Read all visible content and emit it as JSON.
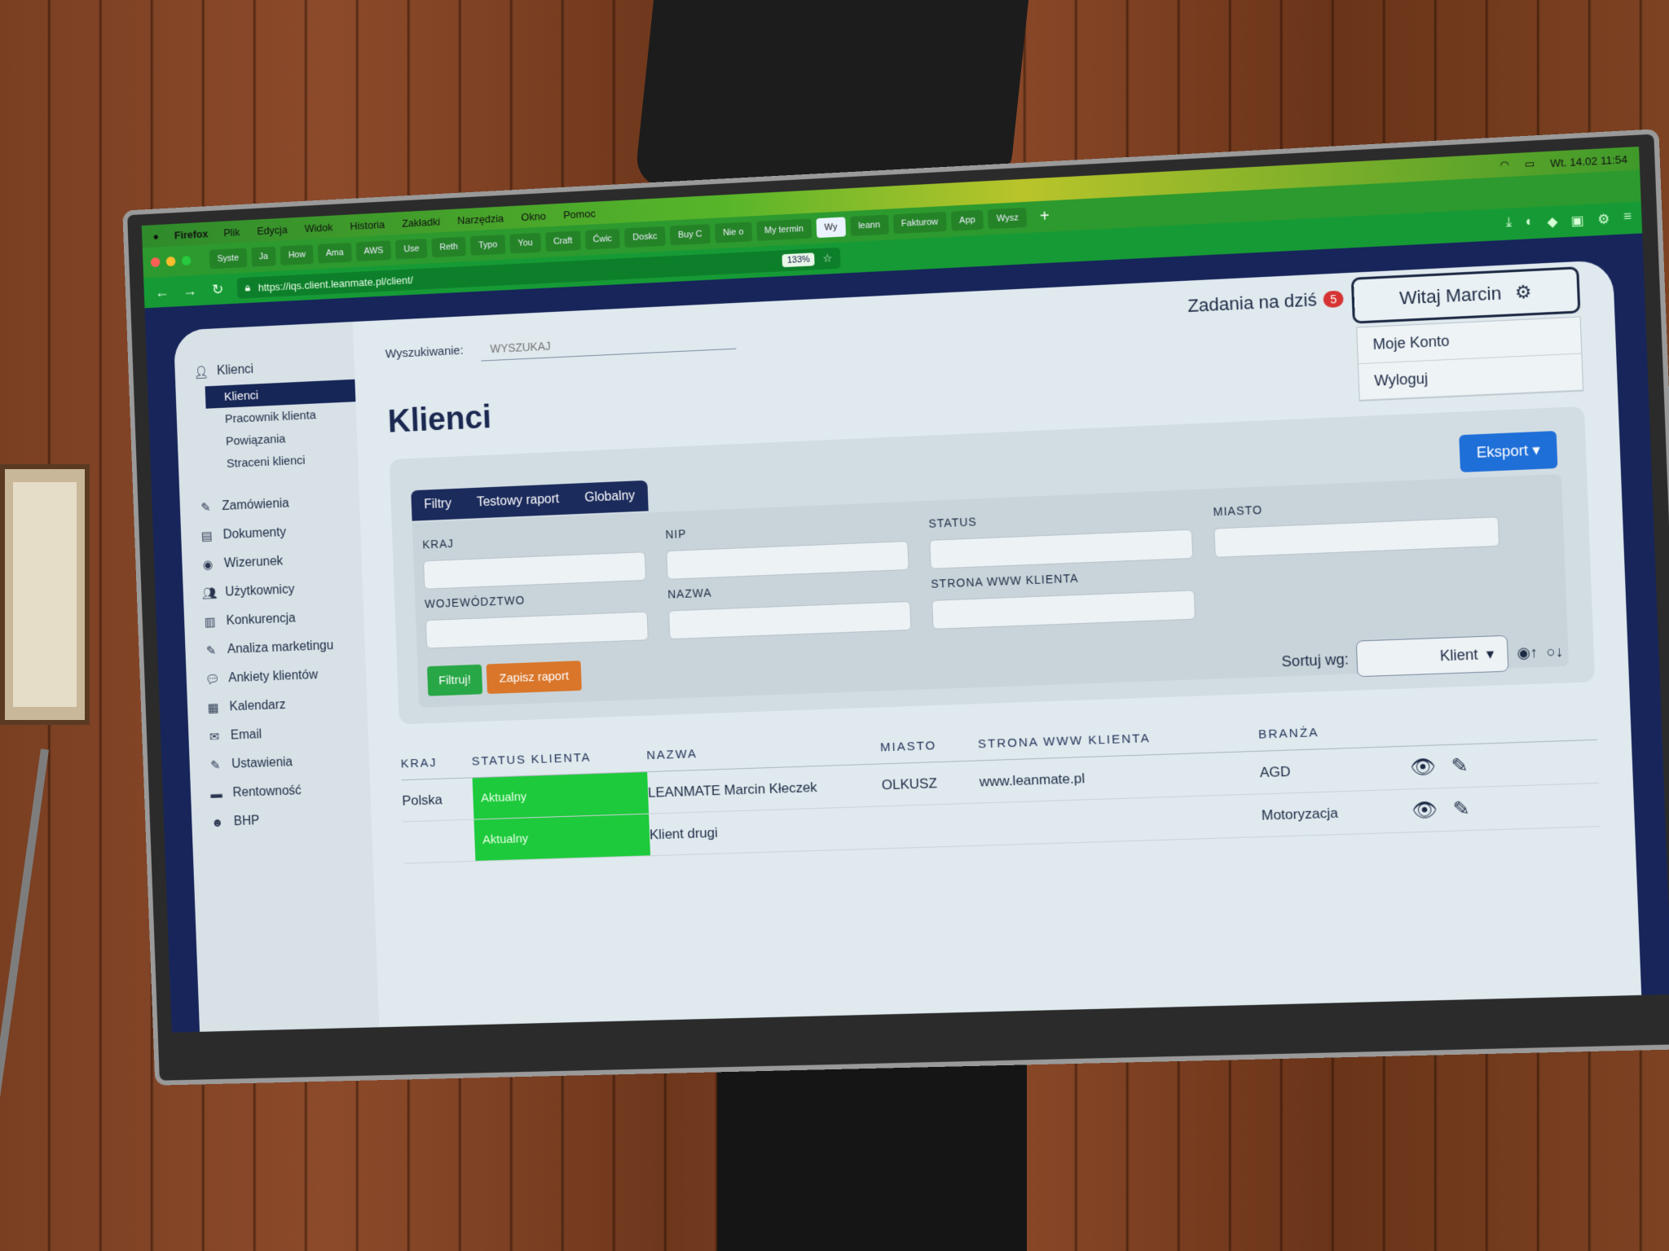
{
  "macbar": {
    "app": "Firefox",
    "menus": [
      "Plik",
      "Edycja",
      "Widok",
      "Historia",
      "Zakładki",
      "Narzędzia",
      "Okno",
      "Pomoc"
    ],
    "clock": "Wt. 14.02 11:54"
  },
  "browser": {
    "tabs": [
      "Syste",
      "Ja",
      "How",
      "Ama",
      "AWS",
      "Use",
      "Reth",
      "Typo",
      "You",
      "Craft",
      "Ćwic",
      "Doskc",
      "Buy C",
      "Nie o",
      "My termin",
      "Wy",
      "leann",
      "Fakturow",
      "App",
      "Wysz"
    ],
    "active_tab_index": 15,
    "url": "https://iqs.client.leanmate.pl/client/",
    "zoom": "133%"
  },
  "sidebar": {
    "section_title": "Klienci",
    "sub_items": [
      "Klienci",
      "Pracownik klienta",
      "Powiązania",
      "Straceni klienci"
    ],
    "items": [
      {
        "label": "Zamówienia",
        "icon": "pencil-icon"
      },
      {
        "label": "Dokumenty",
        "icon": "document-icon"
      },
      {
        "label": "Wizerunek",
        "icon": "eye-icon"
      },
      {
        "label": "Użytkownicy",
        "icon": "users-icon"
      },
      {
        "label": "Konkurencja",
        "icon": "chart-icon"
      },
      {
        "label": "Analiza marketingu",
        "icon": "pencil-icon"
      },
      {
        "label": "Ankiety klientów",
        "icon": "chat-icon"
      },
      {
        "label": "Kalendarz",
        "icon": "calendar-icon"
      },
      {
        "label": "Email",
        "icon": "mail-icon"
      },
      {
        "label": "Ustawienia",
        "icon": "pencil-icon"
      },
      {
        "label": "Rentowność",
        "icon": "money-icon"
      },
      {
        "label": "BHP",
        "icon": "helmet-icon"
      }
    ]
  },
  "header": {
    "search_label": "Wyszukiwanie:",
    "search_placeholder": "WYSZUKAJ",
    "tasks_label": "Zadania na dziś",
    "tasks_count": "5",
    "user_button": "Witaj Marcin",
    "user_menu": [
      "Moje Konto",
      "Wyloguj"
    ]
  },
  "page": {
    "title": "Klienci",
    "export_label": "Eksport",
    "tabs": [
      "Filtry",
      "Testowy raport",
      "Globalny"
    ],
    "filters": [
      {
        "label": "KRAJ"
      },
      {
        "label": "NIP"
      },
      {
        "label": "STATUS"
      },
      {
        "label": "MIASTO"
      },
      {
        "label": "WOJEWÓDZTWO"
      },
      {
        "label": "NAZWA"
      },
      {
        "label": "STRONA WWW KLIENTA"
      }
    ],
    "filter_button": "Filtruj!",
    "save_button": "Zapisz raport",
    "sort_label": "Sortuj wg:",
    "sort_value": "Klient"
  },
  "table": {
    "columns": [
      "KRAJ",
      "STATUS KLIENTA",
      "NAZWA",
      "MIASTO",
      "STRONA WWW KLIENTA",
      "BRANŻA"
    ],
    "rows": [
      {
        "kraj": "Polska",
        "status": "Aktualny",
        "nazwa": "LEANMATE Marcin Kłeczek",
        "miasto": "OLKUSZ",
        "www": "www.leanmate.pl",
        "branza": "AGD"
      },
      {
        "kraj": "",
        "status": "Aktualny",
        "nazwa": "Klient drugi",
        "miasto": "",
        "www": "",
        "branza": "Motoryzacja"
      }
    ]
  }
}
